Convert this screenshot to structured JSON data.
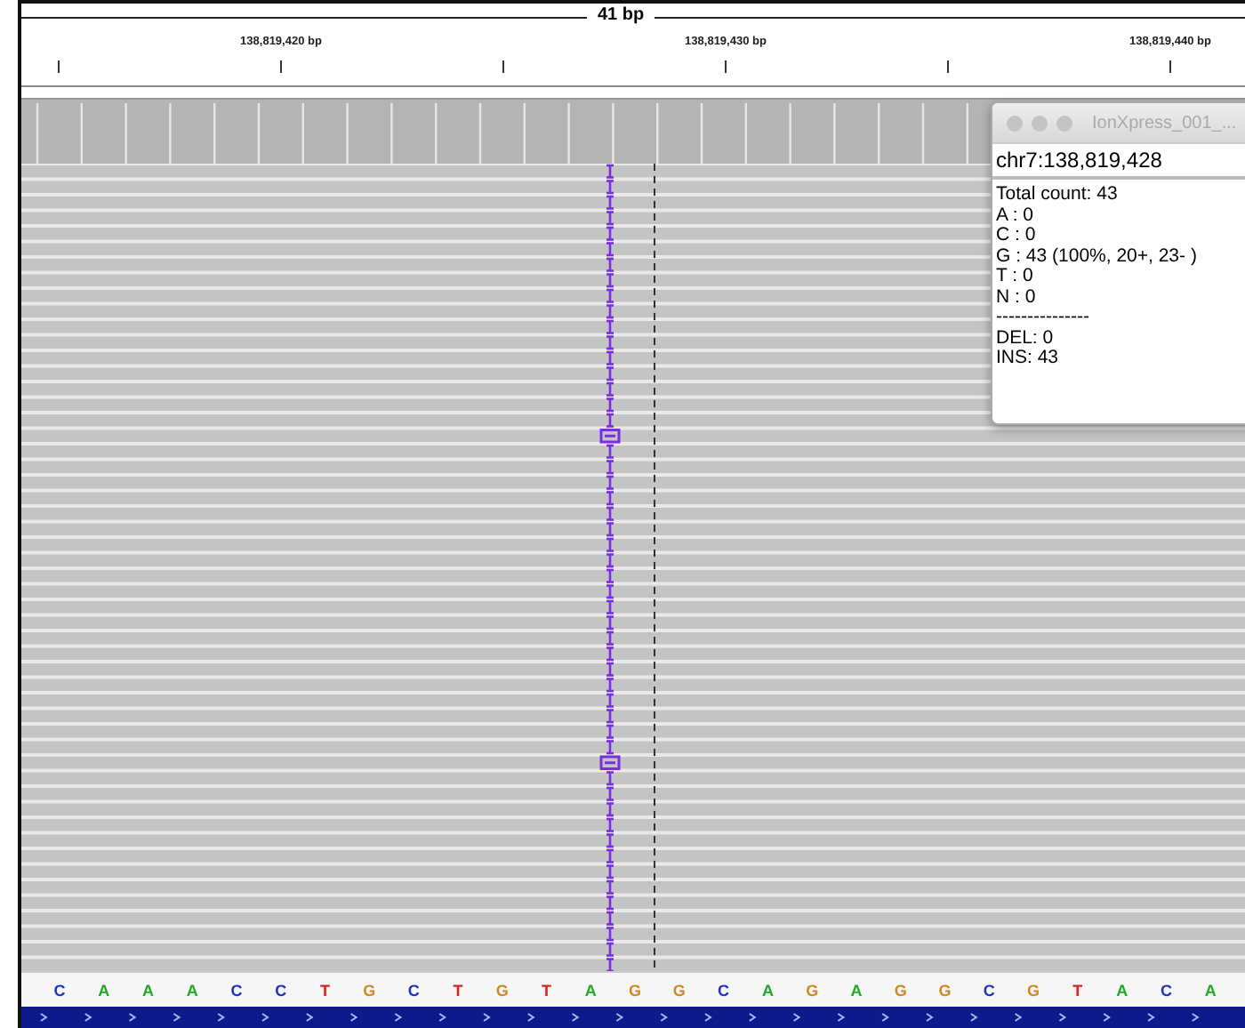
{
  "ruler": {
    "span": "41 bp",
    "labels": [
      "138,819,420 bp",
      "138,819,430 bp",
      "138,819,440 bp"
    ]
  },
  "popup": {
    "title": "IonXpress_001_...",
    "locus": "chr7:138,819,428",
    "lines": [
      "Total count: 43",
      "A : 0",
      "C : 0",
      "G : 43 (100%, 20+, 23- )",
      "T : 0",
      "N : 0",
      "---------------",
      "DEL: 0",
      "INS: 43"
    ]
  },
  "sequence": [
    {
      "base": "C",
      "color": "#2233bb"
    },
    {
      "base": "A",
      "color": "#22aa22"
    },
    {
      "base": "A",
      "color": "#22aa22"
    },
    {
      "base": "A",
      "color": "#22aa22"
    },
    {
      "base": "C",
      "color": "#2233bb"
    },
    {
      "base": "C",
      "color": "#2233bb"
    },
    {
      "base": "T",
      "color": "#dd2222"
    },
    {
      "base": "G",
      "color": "#d18a1e"
    },
    {
      "base": "C",
      "color": "#2233bb"
    },
    {
      "base": "T",
      "color": "#dd2222"
    },
    {
      "base": "G",
      "color": "#d18a1e"
    },
    {
      "base": "T",
      "color": "#dd2222"
    },
    {
      "base": "A",
      "color": "#22aa22"
    },
    {
      "base": "G",
      "color": "#d18a1e"
    },
    {
      "base": "G",
      "color": "#d18a1e"
    },
    {
      "base": "C",
      "color": "#2233bb"
    },
    {
      "base": "A",
      "color": "#22aa22"
    },
    {
      "base": "G",
      "color": "#d18a1e"
    },
    {
      "base": "A",
      "color": "#22aa22"
    },
    {
      "base": "G",
      "color": "#d18a1e"
    },
    {
      "base": "G",
      "color": "#d18a1e"
    },
    {
      "base": "C",
      "color": "#2233bb"
    },
    {
      "base": "G",
      "color": "#d18a1e"
    },
    {
      "base": "T",
      "color": "#dd2222"
    },
    {
      "base": "A",
      "color": "#22aa22"
    },
    {
      "base": "C",
      "color": "#2233bb"
    },
    {
      "base": "A",
      "color": "#22aa22"
    }
  ]
}
